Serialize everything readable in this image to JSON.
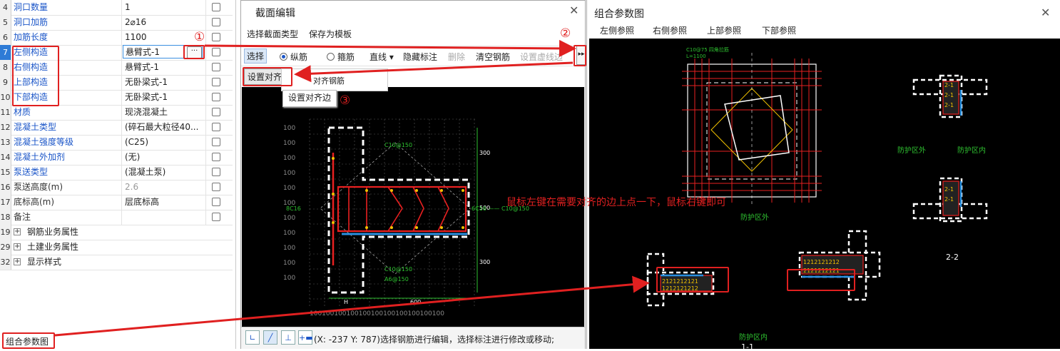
{
  "properties": {
    "rows": [
      {
        "num": "4",
        "name": "洞口数量",
        "value": "1",
        "link": true
      },
      {
        "num": "5",
        "name": "洞口加筋",
        "value": "2⌀16",
        "link": true
      },
      {
        "num": "6",
        "name": "加筋长度",
        "value": "1100",
        "link": true
      },
      {
        "num": "7",
        "name": "左侧构造",
        "value": "悬臂式-1",
        "link": true,
        "selected": true,
        "editing": true
      },
      {
        "num": "8",
        "name": "右侧构造",
        "value": "悬臂式-1",
        "link": true
      },
      {
        "num": "9",
        "name": "上部构造",
        "value": "无卧梁式-1",
        "link": true
      },
      {
        "num": "10",
        "name": "下部构造",
        "value": "无卧梁式-1",
        "link": true
      },
      {
        "num": "11",
        "name": "材质",
        "value": "现浇混凝土",
        "link": true
      },
      {
        "num": "12",
        "name": "混凝土类型",
        "value": "(碎石最大粒径40...",
        "link": true
      },
      {
        "num": "13",
        "name": "混凝土强度等级",
        "value": "(C25)",
        "link": true
      },
      {
        "num": "14",
        "name": "混凝土外加剂",
        "value": "(无)",
        "link": true
      },
      {
        "num": "15",
        "name": "泵送类型",
        "value": "(混凝土泵)",
        "link": true
      },
      {
        "num": "16",
        "name": "泵送高度(m)",
        "value": "2.6",
        "link": false,
        "gray": true
      },
      {
        "num": "17",
        "name": "底标高(m)",
        "value": "层底标高",
        "link": false
      },
      {
        "num": "18",
        "name": "备注",
        "value": "",
        "link": false
      }
    ],
    "groups": [
      {
        "num": "19",
        "name": "钢筋业务属性"
      },
      {
        "num": "29",
        "name": "土建业务属性"
      },
      {
        "num": "32",
        "name": "显示样式"
      }
    ],
    "ellipsis_label": "···",
    "combo_link": "组合参数图"
  },
  "section_editor": {
    "title": "截面编辑",
    "menu": [
      "选择截面类型",
      "保存为模板"
    ],
    "toolbar": {
      "select": "选择",
      "radio_long": "纵筋",
      "radio_stirrup": "箍筋",
      "line": "直线 ▾",
      "hide_label": "隐藏标注",
      "delete": "删除",
      "clear": "清空钢筋",
      "set_dashed": "设置虚线边",
      "more": "▸▸"
    },
    "set_align_button": "设置对齐边",
    "align_rebar_text": "对齐钢筋",
    "tooltip": "设置对齐边",
    "status_text": "(X: -237 Y: 787)选择钢筋进行编辑，选择标注进行修改或移动;",
    "status_buttons": [
      "∟",
      "╱",
      "⊥",
      "+▬"
    ],
    "drawing_labels": {
      "dims_left": [
        "100",
        "100",
        "100",
        "100",
        "100",
        "100",
        "100",
        "100",
        "100",
        "100",
        "100"
      ],
      "dims_bottom": "100100100100100100100100100100100",
      "dim_300_top": "300",
      "dim_500": "500",
      "dim_300_bottom": "300",
      "dim_600": "600",
      "dim_h": "H",
      "rebar_top": "C10@150",
      "rebar_left": "8C16",
      "rebar_right": "6C16 —— C10@150",
      "rebar_bottom1": "C10@150",
      "rebar_bottom2": "A6@150"
    }
  },
  "combo_window": {
    "title": "组合参数图",
    "tabs": [
      "左侧参照",
      "右侧参照",
      "上部参照",
      "下部参照"
    ],
    "labels": {
      "protect_out_1": "防护区外",
      "protect_out_2": "防护区外",
      "protect_in_1": "防护区内",
      "protect_in_2": "防护区内",
      "section_22": "2-2",
      "section_11": "1-1",
      "small_note": "C10@75 四角拉筋",
      "small_note2": "L=1100",
      "mark_2": "2"
    }
  },
  "annotations": {
    "circle_1": "①",
    "circle_2": "②",
    "circle_3": "③",
    "note": "鼠标左键在需要对齐的边上点一下，鼠标右键即可"
  },
  "colors": {
    "accent_red": "#e02020",
    "link_blue": "#1a55c8",
    "canvas_bg": "#000000"
  }
}
